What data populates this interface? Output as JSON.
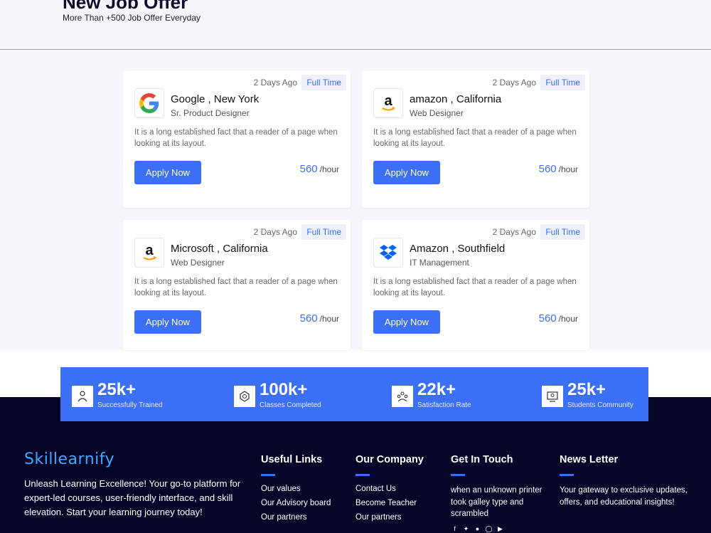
{
  "header": {
    "title": "New Job Offer",
    "subtitle": "More Than +500 Job Offer Everyday"
  },
  "jobs": [
    {
      "days": "2 Days Ago",
      "type": "Full Time",
      "company": "Google , New York",
      "role": "Sr. Product Designer",
      "description": "It is a long established fact that a reader of a page when looking at its layout.",
      "apply_label": "Apply Now",
      "rate_value": "560",
      "rate_unit": "/hour",
      "logo": "google-logo"
    },
    {
      "days": "2 Days Ago",
      "type": "Full Time",
      "company": "amazon , California",
      "role": "Web Designer",
      "description": "It is a long established fact that a reader of a page when looking at its layout.",
      "apply_label": "Apply Now",
      "rate_value": "560",
      "rate_unit": "/hour",
      "logo": "amazon-logo"
    },
    {
      "days": "2 Days Ago",
      "type": "Full Time",
      "company": "Microsoft , California",
      "role": "Web Designer",
      "description": "It is a long established fact that a reader of a page when looking at its layout.",
      "apply_label": "Apply Now",
      "rate_value": "560",
      "rate_unit": "/hour",
      "logo": "amazon-logo"
    },
    {
      "days": "2 Days Ago",
      "type": "Full Time",
      "company": "Amazon , Southfield",
      "role": "IT Management",
      "description": "It is a long established fact that a reader of a page when looking at its layout.",
      "apply_label": "Apply Now",
      "rate_value": "560",
      "rate_unit": "/hour",
      "logo": "dropbox-logo"
    }
  ],
  "stats": [
    {
      "value": "25k+",
      "label": "Successfully Trained",
      "icon": "trainer-icon"
    },
    {
      "value": "100k+",
      "label": "Classes Completed",
      "icon": "badge-icon"
    },
    {
      "value": "22k+",
      "label": "Satisfaction Rate",
      "icon": "group-icon"
    },
    {
      "value": "25k+",
      "label": "Students Community",
      "icon": "community-icon"
    }
  ],
  "footer": {
    "brand": "Skillearnify",
    "tagline": "Unleash Learning Excellence! Your go-to platform for expert-led courses, user-friendly interface, and skill elevation. Start your learning journey today!",
    "useful_links": {
      "title": "Useful Links",
      "items": [
        "Our values",
        "Our Advisory board",
        "Our partners"
      ]
    },
    "company": {
      "title": "Our Company",
      "items": [
        "Contact Us",
        "Become Teacher",
        "Our partners"
      ]
    },
    "touch": {
      "title": "Get In Touch",
      "text": "when an unknown printer took galley type and scrambled"
    },
    "newsletter": {
      "title": "News Letter",
      "text": "Your gateway to exclusive updates, offers, and educational insights!"
    },
    "socials": [
      "facebook-icon",
      "twitter-icon",
      "skype-icon",
      "instagram-icon",
      "youtube-icon"
    ]
  },
  "colors": {
    "accent": "#3b6ff5",
    "dark_footer": "#050527",
    "page_bg": "#f5f6fb",
    "brand": "#3fa8ff"
  }
}
